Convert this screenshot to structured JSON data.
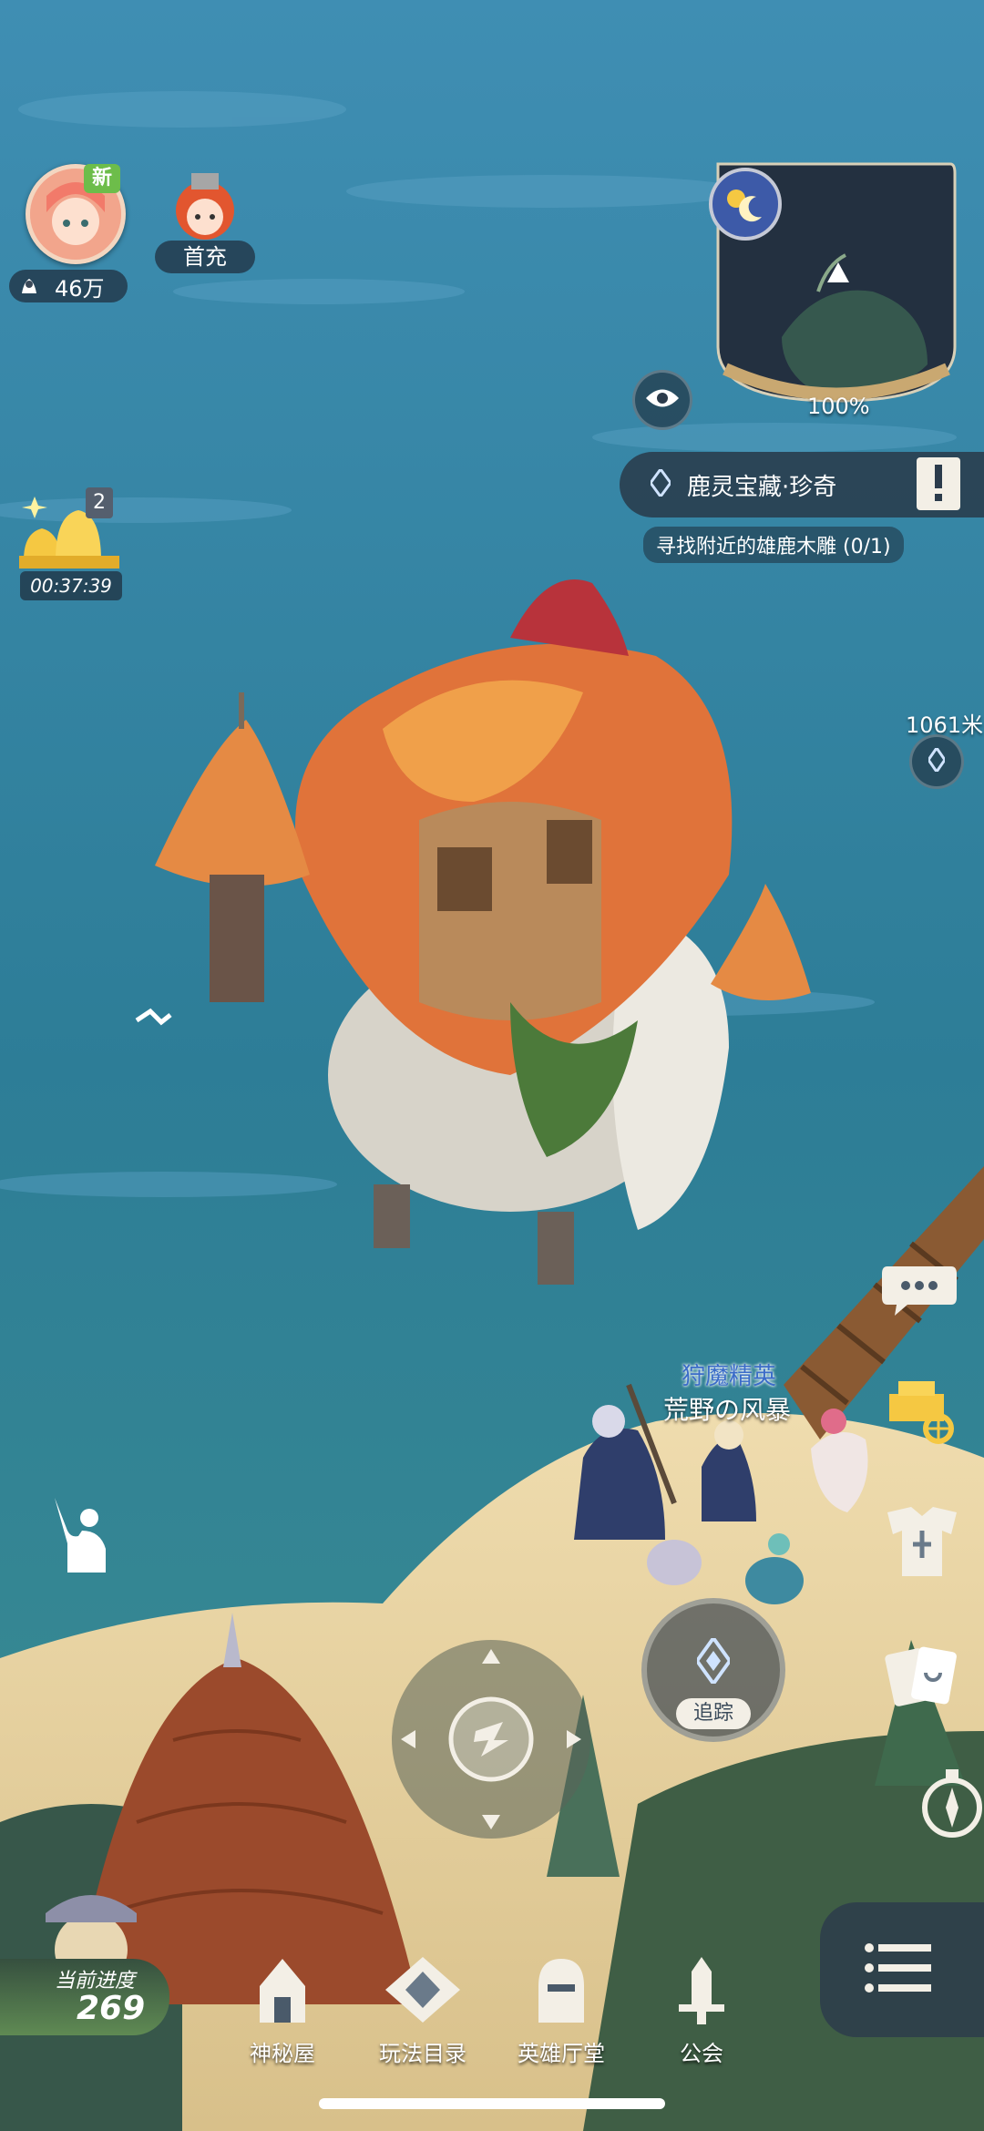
{
  "hud": {
    "new_badge": "新",
    "power_value": "46万",
    "first_charge_label": "首充",
    "gift_count": "2",
    "gift_timer": "00:37:39"
  },
  "minimap": {
    "zoom_label": "100%"
  },
  "quest": {
    "title": "鹿灵宝藏·珍奇",
    "subtitle": "寻找附近的雄鹿木雕 (0/1)"
  },
  "distance": {
    "label": "1061米"
  },
  "party": {
    "title": "狩魔精英",
    "name": "荒野の风暴"
  },
  "track_button": {
    "label": "追踪"
  },
  "progress": {
    "label": "当前进度",
    "value": "269"
  },
  "bottom_nav": [
    {
      "label": "神秘屋",
      "icon": "mystery-house-icon"
    },
    {
      "label": "玩法目录",
      "icon": "gameplay-catalog-icon"
    },
    {
      "label": "英雄厅堂",
      "icon": "hero-hall-icon"
    },
    {
      "label": "公会",
      "icon": "guild-icon"
    }
  ],
  "colors": {
    "sea": "#2f7e97",
    "sand": "#e9d6a8",
    "roof_orange": "#e0733a",
    "accent_gold": "#f5c842"
  }
}
